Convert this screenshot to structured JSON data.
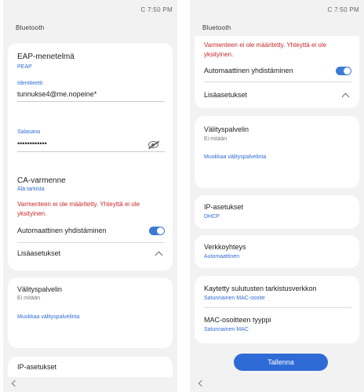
{
  "status": {
    "time": "C 7:50 PM"
  },
  "left": {
    "back_label": "Bluetooth",
    "eap_title": "EAP-menetelmä",
    "eap_value": "PEAP",
    "identity_label": "Identiteetti",
    "identity_value": "tunnukse4@me.nopeine*",
    "password_label": "Salasana",
    "password_value": "••••••••••••",
    "cert_title": "CA-varmenne",
    "cert_value": "Älä tarkista",
    "warning": "Varmenteen ei ole määritetty. Yhteyttä ei ole yksityinen.",
    "auto_reconnect": "Automaattinen yhdistäminen",
    "advanced": "Lisäasetukset",
    "proxy_title": "Välityspalvelin",
    "proxy_value": "Ei mitään",
    "proxy_link": "Muokkaa välityspalvelinta",
    "ip_title": "IP-asetukset"
  },
  "right": {
    "back_label": "Bluetooth",
    "warning": "Varmenteen ei ole määritetty. Yhteyttä ei ole yksityinen.",
    "auto_reconnect": "Automaattinen yhdistäminen",
    "advanced": "Lisäasetukset",
    "proxy_title": "Välityspalvelin",
    "proxy_value": "Ei mitään",
    "proxy_link": "Muokkaa välityspalvelinta",
    "ip_title": "IP-asetukset",
    "ip_value": "DHCP",
    "metered_title": "Verkkoyhteys",
    "metered_value": "Automaattinen",
    "mac_title": "Kaytetty sulutusten tarkistusverkkon",
    "mac_value": "Satunnainen MAC-osoite",
    "mac_type_title": "MAC-osoitteen tyyppi",
    "mac_type_value": "Satunnainen MAC",
    "save_label": "Tallenna"
  }
}
